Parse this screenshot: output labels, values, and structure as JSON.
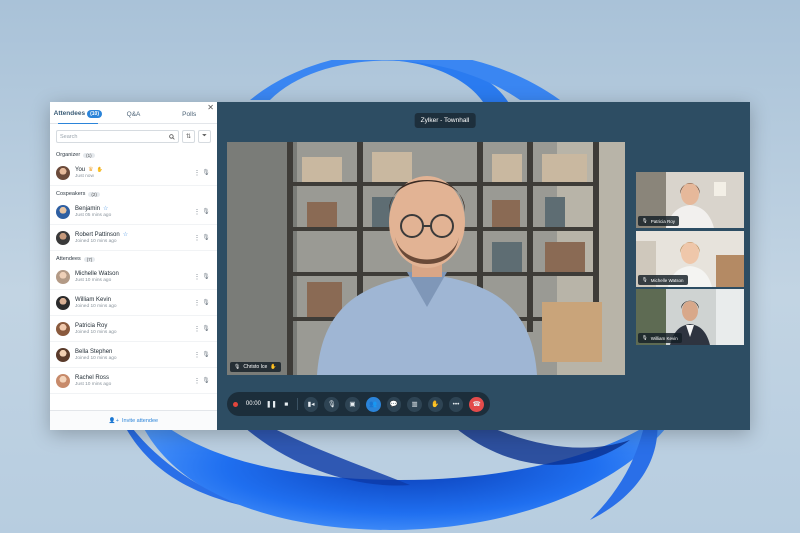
{
  "meeting": {
    "title": "Zylker - Townhall",
    "timer": "00:00",
    "main_speaker": "Christo Ice"
  },
  "panel": {
    "tabs": [
      {
        "label": "Attendees",
        "count": "(10)"
      },
      {
        "label": "Q&A"
      },
      {
        "label": "Polls"
      }
    ],
    "search_placeholder": "Search",
    "sections": {
      "organizer": {
        "label": "Organizer",
        "count": "(1)"
      },
      "cospeakers": {
        "label": "Cospeakers",
        "count": "(2)"
      },
      "attendees": {
        "label": "Attendees",
        "count": "(7)"
      }
    },
    "organizer": [
      {
        "name": "You",
        "status": "Just now"
      }
    ],
    "cospeakers": [
      {
        "name": "Benjamin",
        "status": "Just 05 mins ago"
      },
      {
        "name": "Robert Pattinson",
        "status": "Joined 10 mins ago"
      }
    ],
    "attendees": [
      {
        "name": "Michelle Watson",
        "status": "Just 10 mins ago"
      },
      {
        "name": "William Kevin",
        "status": "Joined 10 mins ago"
      },
      {
        "name": "Patricia Roy",
        "status": "Joined 10 mins ago"
      },
      {
        "name": "Bella Stephen",
        "status": "Joined 10 mins ago"
      },
      {
        "name": "Rachel Ross",
        "status": "Just 10 mins ago"
      }
    ],
    "invite_label": "Invite attendee"
  },
  "thumbnails": [
    {
      "name": "Patricia Roy"
    },
    {
      "name": "Michelle Watson"
    },
    {
      "name": "William Kevin"
    }
  ],
  "colors": {
    "accent": "#2b84d9",
    "window_bg": "#2d4d63",
    "end_call": "#e34b4b"
  },
  "icons": {
    "close": "close-icon",
    "search": "search-icon",
    "sort": "sort-icon",
    "filter": "filter-icon"
  }
}
